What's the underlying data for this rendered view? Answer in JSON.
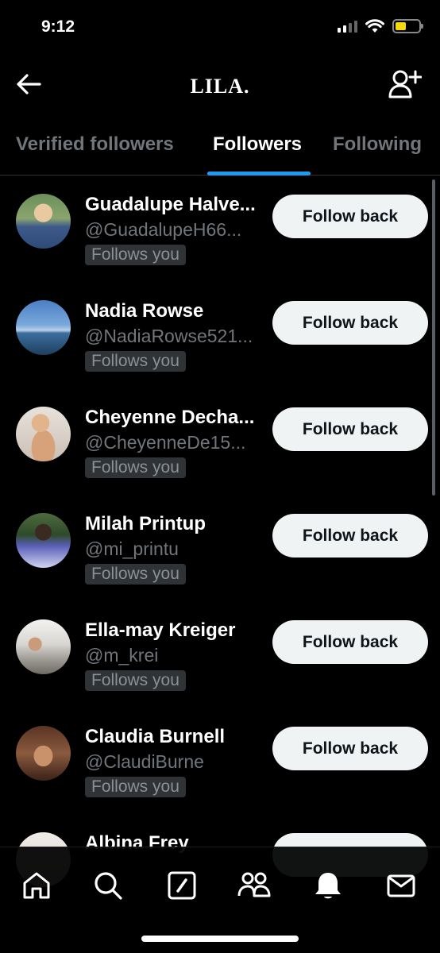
{
  "status_bar": {
    "time": "9:12"
  },
  "header": {
    "title": "LILA."
  },
  "tabs": [
    {
      "label": "Verified followers"
    },
    {
      "label": "Followers",
      "active": true
    },
    {
      "label": "Following"
    }
  ],
  "accent_color": "#1d9bf0",
  "followers": [
    {
      "name": "Guadalupe Halve...",
      "handle": "@GuadalupeH66...",
      "badge": "Follows you",
      "button": "Follow back"
    },
    {
      "name": "Nadia Rowse",
      "handle": "@NadiaRowse521...",
      "badge": "Follows you",
      "button": "Follow back"
    },
    {
      "name": "Cheyenne Decha...",
      "handle": "@CheyenneDe15...",
      "badge": "Follows you",
      "button": "Follow back"
    },
    {
      "name": "Milah Printup",
      "handle": "@mi_printu",
      "badge": "Follows you",
      "button": "Follow back"
    },
    {
      "name": "Ella-may Kreiger",
      "handle": "@m_krei",
      "badge": "Follows you",
      "button": "Follow back"
    },
    {
      "name": "Claudia Burnell",
      "handle": "@ClaudiBurne",
      "badge": "Follows you",
      "button": "Follow back"
    },
    {
      "name": "Albina Frey",
      "handle": "",
      "badge": "",
      "button": ""
    }
  ],
  "bottom_nav": [
    {
      "icon": "home-icon"
    },
    {
      "icon": "search-icon"
    },
    {
      "icon": "compose-icon"
    },
    {
      "icon": "communities-icon"
    },
    {
      "icon": "notifications-icon"
    },
    {
      "icon": "messages-icon"
    }
  ]
}
